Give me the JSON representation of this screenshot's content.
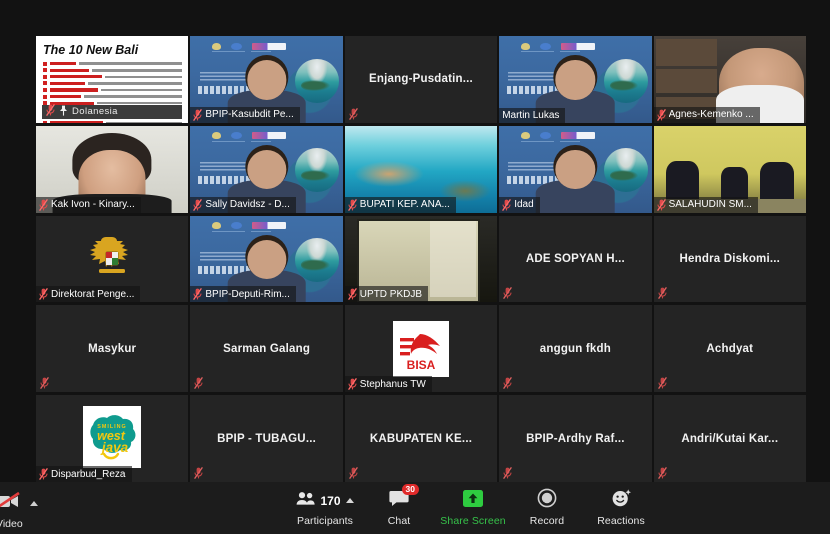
{
  "app": {
    "name": "zoom-meeting-gallery-view",
    "active_speaker_border_color": "#c8e04a",
    "background_color": "#121212"
  },
  "gallery": {
    "tiles": [
      {
        "name": "Dolanesia",
        "kind": "screen-share-slide",
        "muted": true,
        "active_speaker": true,
        "pinned": true,
        "slide": {
          "title": "The 10 New Bali",
          "brand": "Dolanesia",
          "bullet_count": 11
        }
      },
      {
        "name": "BPIP-Kasubdit Pe...",
        "kind": "video-virtual-bg",
        "muted": true,
        "active_speaker": false
      },
      {
        "name": "Enjang-Pusdatin...",
        "kind": "name-only",
        "muted": true,
        "active_speaker": false
      },
      {
        "name": "Martin Lukas",
        "kind": "video-virtual-bg",
        "muted": false,
        "active_speaker": false
      },
      {
        "name": "Agnes-Kemenko ...",
        "kind": "video-bookshelf",
        "muted": true,
        "active_speaker": false
      },
      {
        "name": "Kak Ivon - Kinary...",
        "kind": "video-white-bg",
        "muted": true,
        "active_speaker": false
      },
      {
        "name": "Sally Davidsz - D...",
        "kind": "video-virtual-bg",
        "muted": true,
        "active_speaker": false
      },
      {
        "name": "BUPATI KEP. ANA...",
        "kind": "video-sea",
        "muted": true,
        "active_speaker": false
      },
      {
        "name": "Idad",
        "kind": "video-virtual-bg",
        "muted": true,
        "active_speaker": false
      },
      {
        "name": "SALAHUDIN SM...",
        "kind": "video-room",
        "muted": true,
        "active_speaker": false
      },
      {
        "name": "Direktorat Penge...",
        "kind": "avatar-garuda",
        "muted": true,
        "active_speaker": false
      },
      {
        "name": "BPIP-Deputi-Rim...",
        "kind": "video-virtual-bg",
        "muted": true,
        "active_speaker": false
      },
      {
        "name": "UPTD PKDJB",
        "kind": "video-wall",
        "muted": true,
        "active_speaker": false
      },
      {
        "name": "ADE SOPYAN H...",
        "kind": "name-only",
        "muted": true,
        "active_speaker": false
      },
      {
        "name": "Hendra  Diskomi...",
        "kind": "name-only",
        "muted": true,
        "active_speaker": false
      },
      {
        "name": "Masykur",
        "kind": "name-only",
        "muted": true,
        "active_speaker": false
      },
      {
        "name": "Sarman Galang",
        "kind": "name-only",
        "muted": true,
        "active_speaker": false
      },
      {
        "name": "Stephanus TW",
        "kind": "avatar-bisa",
        "muted": true,
        "active_speaker": false,
        "logo_text": "BISA"
      },
      {
        "name": "anggun fkdh",
        "kind": "name-only",
        "muted": true,
        "active_speaker": false
      },
      {
        "name": "Achdyat",
        "kind": "name-only",
        "muted": true,
        "active_speaker": false
      },
      {
        "name": "Disparbud_Reza",
        "kind": "avatar-westjava",
        "muted": true,
        "active_speaker": false,
        "logo_text_top": "SMILING",
        "logo_text_mid": "west",
        "logo_text_bot": "java"
      },
      {
        "name": "BPIP - TUBAGU...",
        "kind": "name-only",
        "muted": true,
        "active_speaker": false
      },
      {
        "name": "KABUPATEN KE...",
        "kind": "name-only",
        "muted": true,
        "active_speaker": false
      },
      {
        "name": "BPIP-Ardhy Raf...",
        "kind": "name-only",
        "muted": true,
        "active_speaker": false
      },
      {
        "name": "Andri/Kutai Kar...",
        "kind": "name-only",
        "muted": true,
        "active_speaker": false
      }
    ]
  },
  "toolbar": {
    "video_control": {
      "label": "Video",
      "state": "stopped",
      "icon": "video-off-icon"
    },
    "participants": {
      "label": "Participants",
      "count": "170",
      "icon": "participants-icon"
    },
    "chat": {
      "label": "Chat",
      "badge": "30",
      "icon": "chat-icon"
    },
    "share_screen": {
      "label": "Share Screen",
      "icon": "share-screen-icon",
      "color": "#36c24a"
    },
    "record": {
      "label": "Record",
      "icon": "record-icon"
    },
    "reactions": {
      "label": "Reactions",
      "icon": "reactions-icon"
    }
  }
}
